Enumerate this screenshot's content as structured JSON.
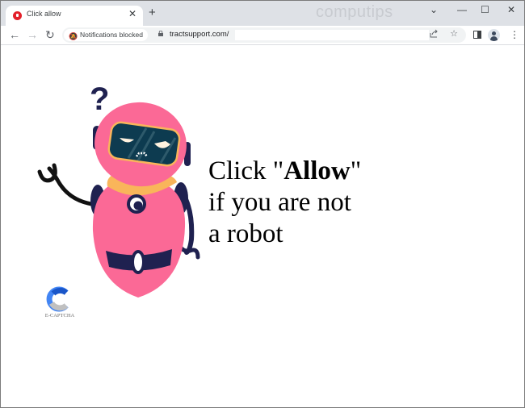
{
  "browser": {
    "tab": {
      "title": "Click allow",
      "favicon": "red-circle-favicon"
    },
    "new_tab_label": "+",
    "watermark": "computips",
    "window_controls": {
      "tab_search": "⌄",
      "minimize": "—",
      "maximize": "☐",
      "close": "✕"
    },
    "nav": {
      "back": "←",
      "forward": "→",
      "reload": "↻"
    },
    "notification_chip": "Notifications blocked",
    "url": "tractsupport.com/",
    "omnibox_icons": {
      "share": "share-icon",
      "bookmark": "☆"
    },
    "menu": "⋮"
  },
  "page": {
    "message": {
      "line1_prefix": "Click \"",
      "line1_bold": "Allow",
      "line1_suffix": "\"",
      "line2": "if you are not",
      "line3": "a robot"
    },
    "captcha_label": "E-CAPTCHA",
    "robot_question_mark": "?"
  },
  "colors": {
    "robot_pink": "#fb6996",
    "robot_dark": "#1f2150",
    "robot_collar": "#f9b55a",
    "visor": "#0d3b50",
    "captcha_blue": "#4285f4",
    "captcha_gray": "#c0c0c0"
  }
}
